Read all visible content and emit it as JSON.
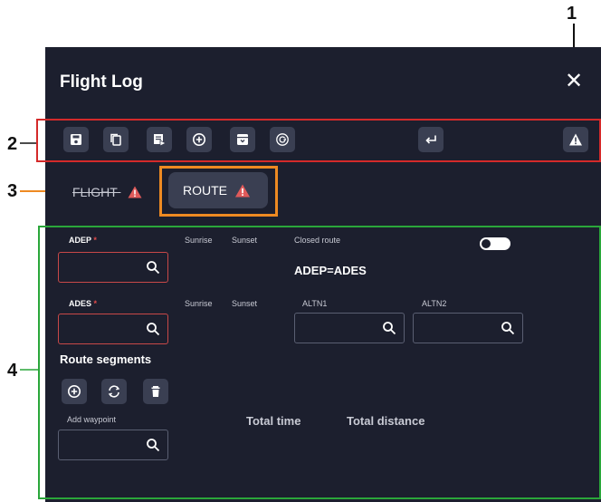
{
  "callouts": [
    "1",
    "2",
    "3",
    "4"
  ],
  "window": {
    "title": "Flight Log",
    "close_glyph": "✕"
  },
  "toolbar": {
    "icons": [
      "save-icon",
      "copy-icon",
      "export-icon",
      "add-circle-icon",
      "archive-icon",
      "reload-icon",
      "return-icon",
      "warning-icon"
    ]
  },
  "tabs": {
    "flight": "FLIGHT",
    "route": "ROUTE"
  },
  "route": {
    "adep_label": "ADEP",
    "ades_label": "ADES",
    "required_mark": "*",
    "sunrise": "Sunrise",
    "sunset": "Sunset",
    "closed_route_label": "Closed route",
    "closed_route_on": false,
    "adep_equals_ades": "ADEP=ADES",
    "altn1_label": "ALTN1",
    "altn2_label": "ALTN2",
    "route_segments_label": "Route segments",
    "add_waypoint_label": "Add waypoint",
    "total_time_label": "Total time",
    "total_distance_label": "Total distance"
  },
  "colors": {
    "panel_bg": "#1c1f2e",
    "button_bg": "#3a3f52",
    "warning": "#e05a5a",
    "callout_red": "#d42a2a",
    "callout_orange": "#ee8a22",
    "callout_green": "#2aa63a"
  }
}
